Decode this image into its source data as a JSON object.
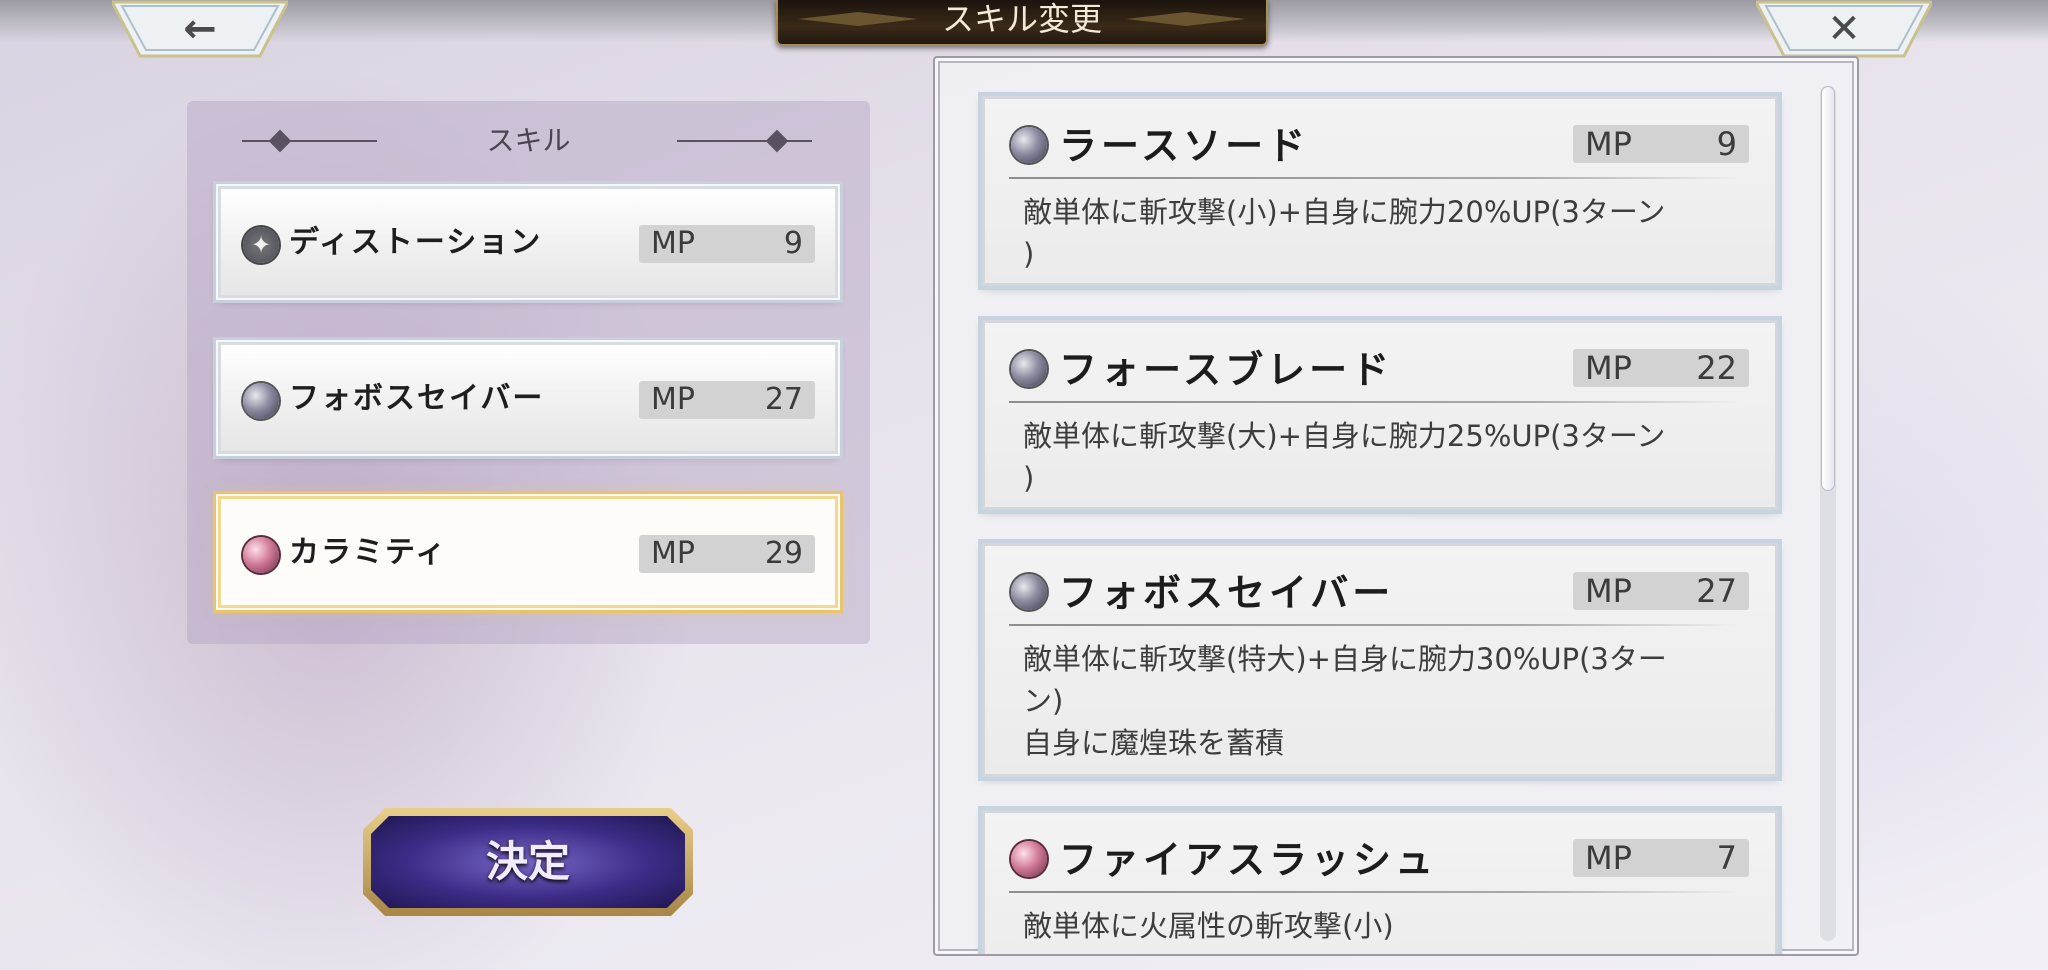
{
  "header": {
    "title": "スキル変更",
    "back_glyph": "←",
    "close_glyph": "✕"
  },
  "left_panel": {
    "heading": "スキル",
    "slots": [
      {
        "name": "ディストーション",
        "mp_label": "MP",
        "mp": "9",
        "icon": "star-gem-icon",
        "selected": false
      },
      {
        "name": "フォボスセイバー",
        "mp_label": "MP",
        "mp": "27",
        "icon": "grey-gem-icon",
        "selected": false
      },
      {
        "name": "カラミティ",
        "mp_label": "MP",
        "mp": "29",
        "icon": "pink-gem-icon",
        "selected": true
      }
    ]
  },
  "decide_button": {
    "label": "決定"
  },
  "skill_list": [
    {
      "name": "ラースソード",
      "mp_label": "MP",
      "mp": "9",
      "icon": "grey-gem-icon",
      "desc": [
        "敵単体に斬攻撃(小)+自身に腕力20%UP(3ターン",
        ")"
      ]
    },
    {
      "name": "フォースブレード",
      "mp_label": "MP",
      "mp": "22",
      "icon": "grey-gem-icon",
      "desc": [
        "敵単体に斬攻撃(大)+自身に腕力25%UP(3ターン",
        ")"
      ]
    },
    {
      "name": "フォボスセイバー",
      "mp_label": "MP",
      "mp": "27",
      "icon": "grey-gem-icon",
      "desc": [
        "敵単体に斬攻撃(特大)+自身に腕力30%UP(3ター",
        "ン)",
        "自身に魔煌珠を蓄積"
      ]
    },
    {
      "name": "ファイアスラッシュ",
      "mp_label": "MP",
      "mp": "7",
      "icon": "pink-gem-icon",
      "desc": [
        "敵単体に火属性の斬攻撃(小)"
      ]
    }
  ],
  "colors": {
    "selected_border": "#e8c56a",
    "decide_fill": "#3c2c86",
    "title_plate": "#2a1e12"
  }
}
